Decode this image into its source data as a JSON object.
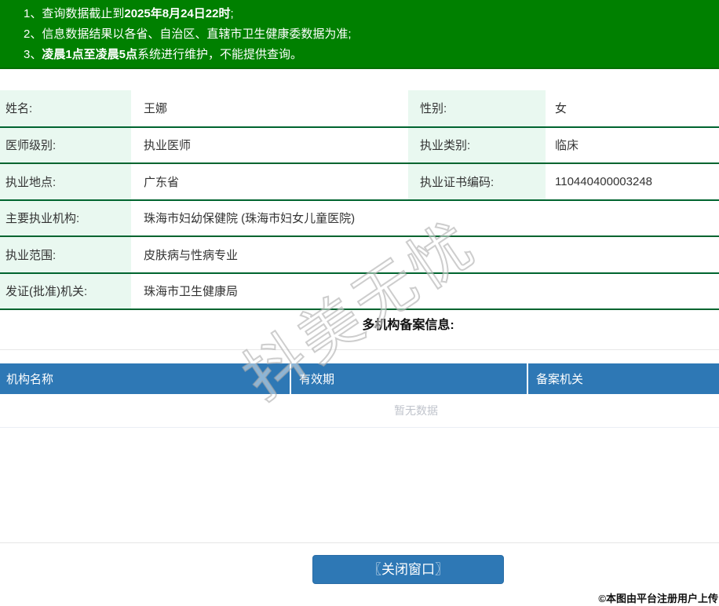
{
  "colors": {
    "banner_green": "#008000",
    "row_divider_green": "#00642f",
    "label_bg_mint": "#e9f8f0",
    "table_header_blue": "#2e78b5",
    "button_blue": "#2e78b5",
    "empty_text_gray": "#c0c4cc"
  },
  "notices": {
    "line1": {
      "num": "1、",
      "pre": "查询数据截止到",
      "bold": "2025年8月24日22时",
      "post": ";"
    },
    "line2": {
      "num": "2、",
      "pre": "信息数据结果以各省、自治区、直辖市卫生健康委数据为准;",
      "bold": "",
      "post": ""
    },
    "line3": {
      "num": "3、",
      "pre": "",
      "bold": "凌晨1点至凌晨5点",
      "post": "系统进行维护，不能提供查询。"
    }
  },
  "info": {
    "row1": {
      "label1": "姓名:",
      "value1": "王娜",
      "label2": "性别:",
      "value2": "女"
    },
    "row2": {
      "label1": "医师级别:",
      "value1": "执业医师",
      "label2": "执业类别:",
      "value2": "临床"
    },
    "row3": {
      "label1": "执业地点:",
      "value1": "广东省",
      "label2": "执业证书编码:",
      "value2": "110440400003248"
    },
    "row4": {
      "label": "主要执业机构:",
      "value": "珠海市妇幼保健院 (珠海市妇女儿童医院)"
    },
    "row5": {
      "label": "执业范围:",
      "value": "皮肤病与性病专业"
    },
    "row6": {
      "label": "发证(批准)机关:",
      "value": "珠海市卫生健康局"
    }
  },
  "filing": {
    "section_title": "多机构备案信息:",
    "headers": [
      "机构名称",
      "有效期",
      "备案机关"
    ],
    "empty_text": "暂无数据"
  },
  "footer": {
    "close_button": "〖关闭窗口〗",
    "photo_credit": "©本图由平台注册用户上传"
  },
  "watermark": "抖美无忧"
}
